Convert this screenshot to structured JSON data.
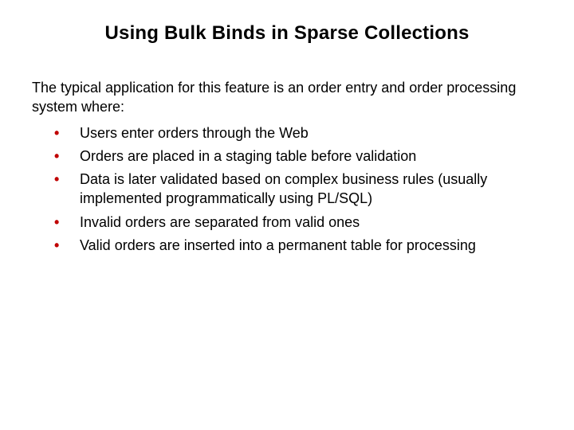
{
  "slide": {
    "title": "Using Bulk Binds in Sparse Collections",
    "intro": "The typical application for this feature is an order entry and order processing system where:",
    "bullets": [
      "Users enter orders through the Web",
      "Orders are placed in a staging table before validation",
      "Data is later validated based on complex business rules (usually implemented programmatically using PL/SQL)",
      "Invalid orders are separated from valid ones",
      "Valid orders are inserted into a permanent table for processing"
    ]
  }
}
